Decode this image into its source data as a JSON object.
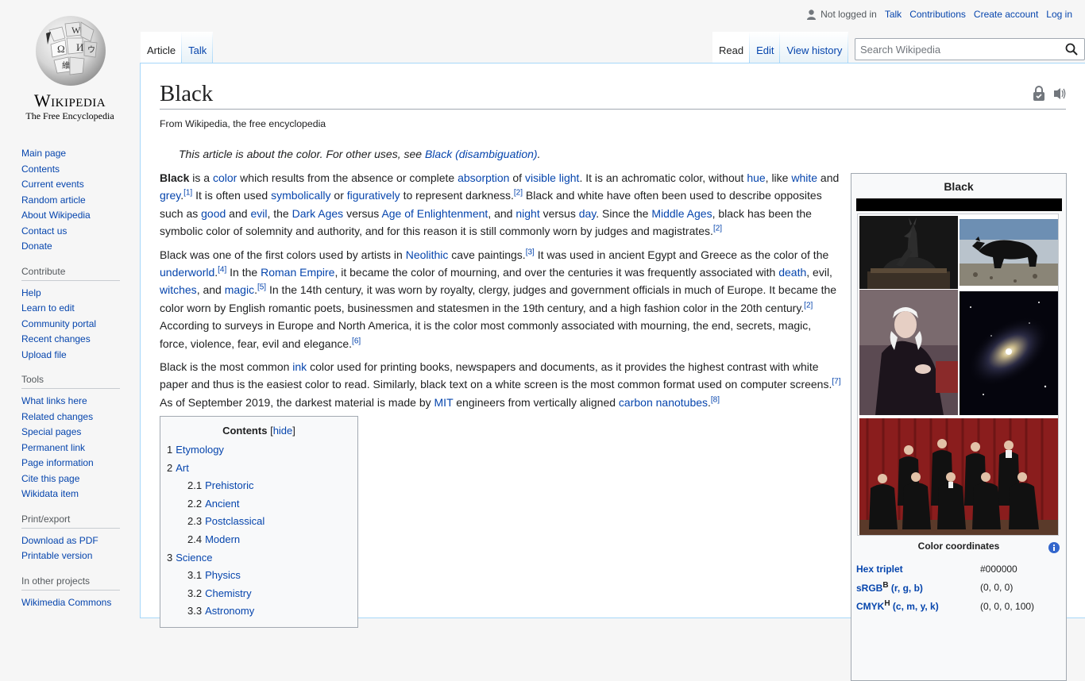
{
  "logo": {
    "wordmark": "Wikipedia",
    "tagline": "The Free Encyclopedia"
  },
  "sidebar": {
    "navigation": [
      "Main page",
      "Contents",
      "Current events",
      "Random article",
      "About Wikipedia",
      "Contact us",
      "Donate"
    ],
    "contribute_title": "Contribute",
    "contribute": [
      "Help",
      "Learn to edit",
      "Community portal",
      "Recent changes",
      "Upload file"
    ],
    "tools_title": "Tools",
    "tools": [
      "What links here",
      "Related changes",
      "Special pages",
      "Permanent link",
      "Page information",
      "Cite this page",
      "Wikidata item"
    ],
    "print_title": "Print/export",
    "print": [
      "Download as PDF",
      "Printable version"
    ],
    "projects_title": "In other projects",
    "projects": [
      "Wikimedia Commons"
    ]
  },
  "personal": {
    "not_logged_in": "Not logged in",
    "talk": "Talk",
    "contributions": "Contributions",
    "create_account": "Create account",
    "log_in": "Log in"
  },
  "tabs": {
    "article": "Article",
    "talk": "Talk",
    "read": "Read",
    "edit": "Edit",
    "view_history": "View history"
  },
  "search": {
    "placeholder": "Search Wikipedia"
  },
  "page": {
    "title": "Black",
    "site_sub": "From Wikipedia, the free encyclopedia",
    "hatnote_text": "This article is about the color. For other uses, see ",
    "hatnote_link": "Black (disambiguation)",
    "hatnote_end": "."
  },
  "p1": {
    "t0": "Black",
    "t1": " is a ",
    "l1": "color",
    "t2": " which results from the absence or complete ",
    "l2": "absorption",
    "t3": " of ",
    "l3": "visible light",
    "t4": ". It is an achromatic color, without ",
    "l4": "hue",
    "t5": ", like ",
    "l5": "white",
    "t6": " and ",
    "l6": "grey",
    "t7": ".",
    "r1": "[1]",
    "t8": " It is often used ",
    "l7": "symbolically",
    "t9": " or ",
    "l8": "figuratively",
    "t10": " to represent darkness.",
    "r2": "[2]",
    "t11": " Black and white have often been used to describe opposites such as ",
    "l9": "good",
    "t12": " and ",
    "l10": "evil",
    "t13": ", the ",
    "l11": "Dark Ages",
    "t14": " versus ",
    "l12": "Age of Enlightenment",
    "t15": ", and ",
    "l13": "night",
    "t16": " versus ",
    "l14": "day",
    "t17": ". Since the ",
    "l15": "Middle Ages",
    "t18": ", black has been the symbolic color of solemnity and authority, and for this reason it is still commonly worn by judges and magistrates.",
    "r3": "[2]"
  },
  "p2": {
    "t1": "Black was one of the first colors used by artists in ",
    "l1": "Neolithic",
    "t2": " cave paintings.",
    "r1": "[3]",
    "t3": " It was used in ancient Egypt and Greece as the color of the ",
    "l2": "underworld",
    "t4": ".",
    "r2": "[4]",
    "t5": " In the ",
    "l3": "Roman Empire",
    "t6": ", it became the color of mourning, and over the centuries it was frequently associated with ",
    "l4": "death",
    "t7": ", evil, ",
    "l5": "witches",
    "t8": ", and ",
    "l6": "magic",
    "t9": ".",
    "r3": "[5]",
    "t10": " In the 14th century, it was worn by royalty, clergy, judges and government officials in much of Europe. It became the color worn by English romantic poets, businessmen and statesmen in the 19th century, and a high fashion color in the 20th century.",
    "r4": "[2]",
    "t11": " According to surveys in Europe and North America, it is the color most commonly associated with mourning, the end, secrets, magic, force, violence, fear, evil and elegance.",
    "r5": "[6]"
  },
  "p3": {
    "t1": "Black is the most common ",
    "l1": "ink",
    "t2": " color used for printing books, newspapers and documents, as it provides the highest contrast with white paper and thus is the easiest color to read. Similarly, black text on a white screen is the most common format used on computer screens.",
    "r1": "[7]",
    "t3": " As of September 2019, the darkest material is made by ",
    "l2": "MIT",
    "t4": " engineers from vertically aligned ",
    "l3": "carbon nanotubes",
    "t5": ".",
    "r2": "[8]"
  },
  "toc": {
    "title": "Contents",
    "toggle_open": "[",
    "toggle": "hide",
    "toggle_close": "]",
    "items": [
      {
        "num": "1",
        "label": "Etymology"
      },
      {
        "num": "2",
        "label": "Art"
      },
      {
        "num": "2.1",
        "label": "Prehistoric"
      },
      {
        "num": "2.2",
        "label": "Ancient"
      },
      {
        "num": "2.3",
        "label": "Postclassical"
      },
      {
        "num": "2.4",
        "label": "Modern"
      },
      {
        "num": "3",
        "label": "Science"
      },
      {
        "num": "3.1",
        "label": "Physics"
      },
      {
        "num": "3.2",
        "label": "Chemistry"
      },
      {
        "num": "3.3",
        "label": "Astronomy"
      }
    ]
  },
  "infobox": {
    "title": "Black",
    "swatch_color": "#000000",
    "coords_title": "Color coordinates",
    "rows": [
      {
        "key": "Hex triplet",
        "sup": "",
        "extra": "",
        "value": "#000000"
      },
      {
        "key": "sRGB",
        "sup": "B",
        "extra": " (r, g, b)",
        "value": "(0, 0, 0)"
      },
      {
        "key": "CMYK",
        "sup": "H",
        "extra": " (c, m, y, k)",
        "value": "(0, 0, 0, 100)"
      }
    ]
  },
  "colors": {
    "link": "#0645ad",
    "text": "#202122",
    "border": "#a2a9b1",
    "tab_border": "#a7d7f9",
    "page_bg": "#f6f6f6"
  }
}
